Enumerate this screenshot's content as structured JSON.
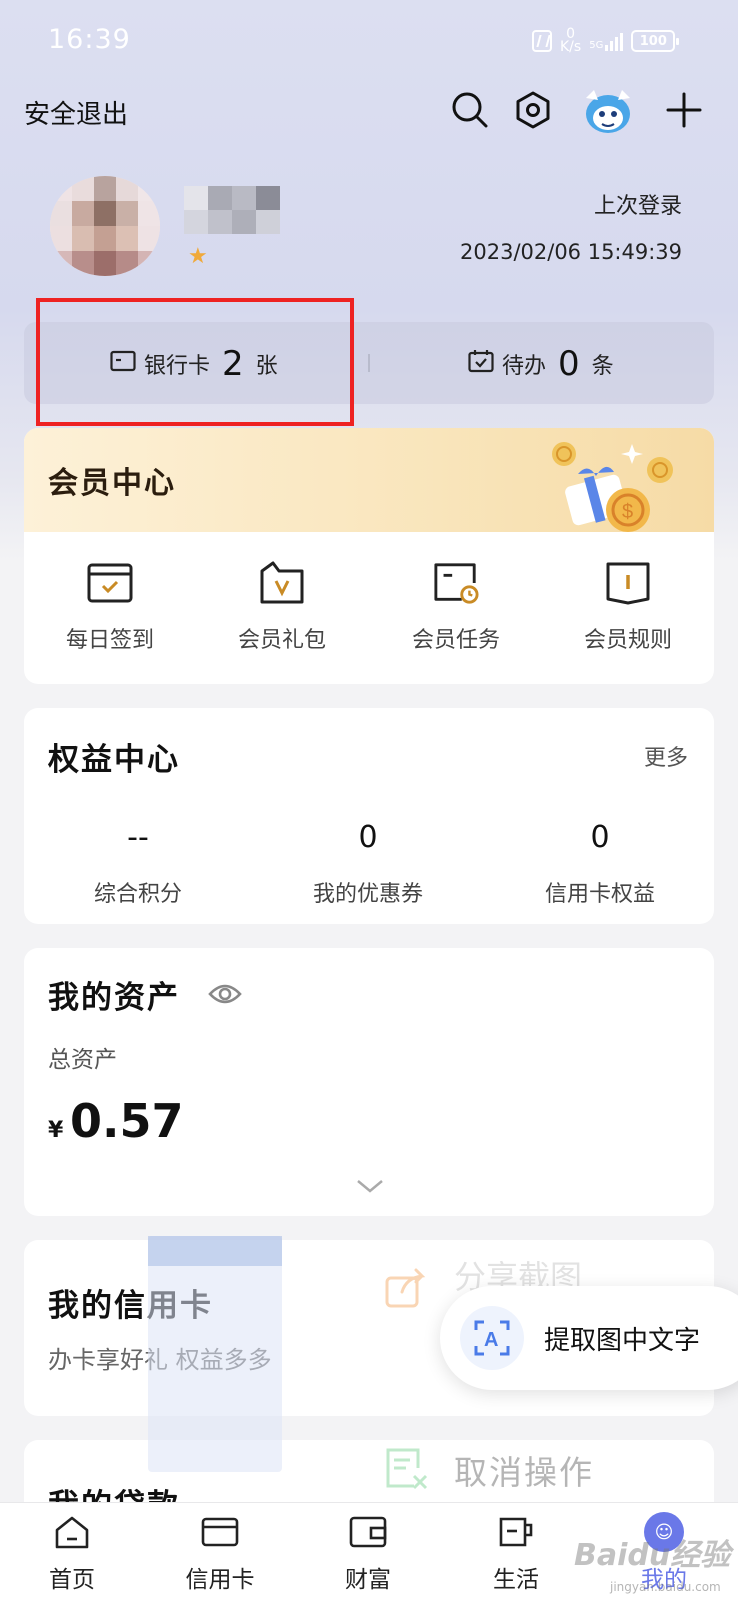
{
  "status_bar": {
    "time": "16:39",
    "net_speed_top": "0",
    "net_speed_bottom": "K/s",
    "signal_label": "5G",
    "battery": "100"
  },
  "header": {
    "logout_label": "安全退出",
    "icons": [
      "search-icon",
      "settings-icon",
      "mascot-avatar",
      "plus-icon"
    ]
  },
  "profile": {
    "last_login_label": "上次登录",
    "last_login_time": "2023/02/06 15:49:39"
  },
  "quick": {
    "bank_card_label": "银行卡",
    "bank_card_count": "2",
    "bank_card_unit": "张",
    "todo_label": "待办",
    "todo_count": "0",
    "todo_unit": "条"
  },
  "member": {
    "title": "会员中心",
    "items": [
      {
        "label": "每日签到",
        "icon": "calendar-check-icon"
      },
      {
        "label": "会员礼包",
        "icon": "gift-folder-icon"
      },
      {
        "label": "会员任务",
        "icon": "task-clock-icon"
      },
      {
        "label": "会员规则",
        "icon": "rule-book-icon"
      }
    ]
  },
  "rights": {
    "title": "权益中心",
    "more": "更多",
    "items": [
      {
        "value": "--",
        "label": "综合积分"
      },
      {
        "value": "0",
        "label": "我的优惠券"
      },
      {
        "value": "0",
        "label": "信用卡权益"
      }
    ]
  },
  "assets": {
    "title": "我的资产",
    "total_label": "总资产",
    "currency": "¥",
    "amount": "0.57"
  },
  "credit": {
    "title": "我的信用卡",
    "subtitle": "办卡享好礼 权益多多"
  },
  "loan": {
    "title": "我的贷款"
  },
  "overlay": {
    "share_text": "分享截图",
    "ocr_text": "提取图中文字",
    "cancel_text": "取消操作"
  },
  "bottom_nav": {
    "items": [
      {
        "label": "首页",
        "icon": "home-icon"
      },
      {
        "label": "信用卡",
        "icon": "credit-card-icon"
      },
      {
        "label": "财富",
        "icon": "wallet-icon"
      },
      {
        "label": "生活",
        "icon": "coffee-cup-icon"
      },
      {
        "label": "我的",
        "icon": "profile-icon",
        "active": true
      }
    ]
  },
  "watermark": {
    "text": "Baidu经验",
    "sub": "jingyan.baidu.com"
  },
  "colors": {
    "header_bg": "#d8dbef",
    "member_gold": "#f6dba6",
    "highlight_red": "#ee2222",
    "nav_active": "#6a78e8"
  }
}
